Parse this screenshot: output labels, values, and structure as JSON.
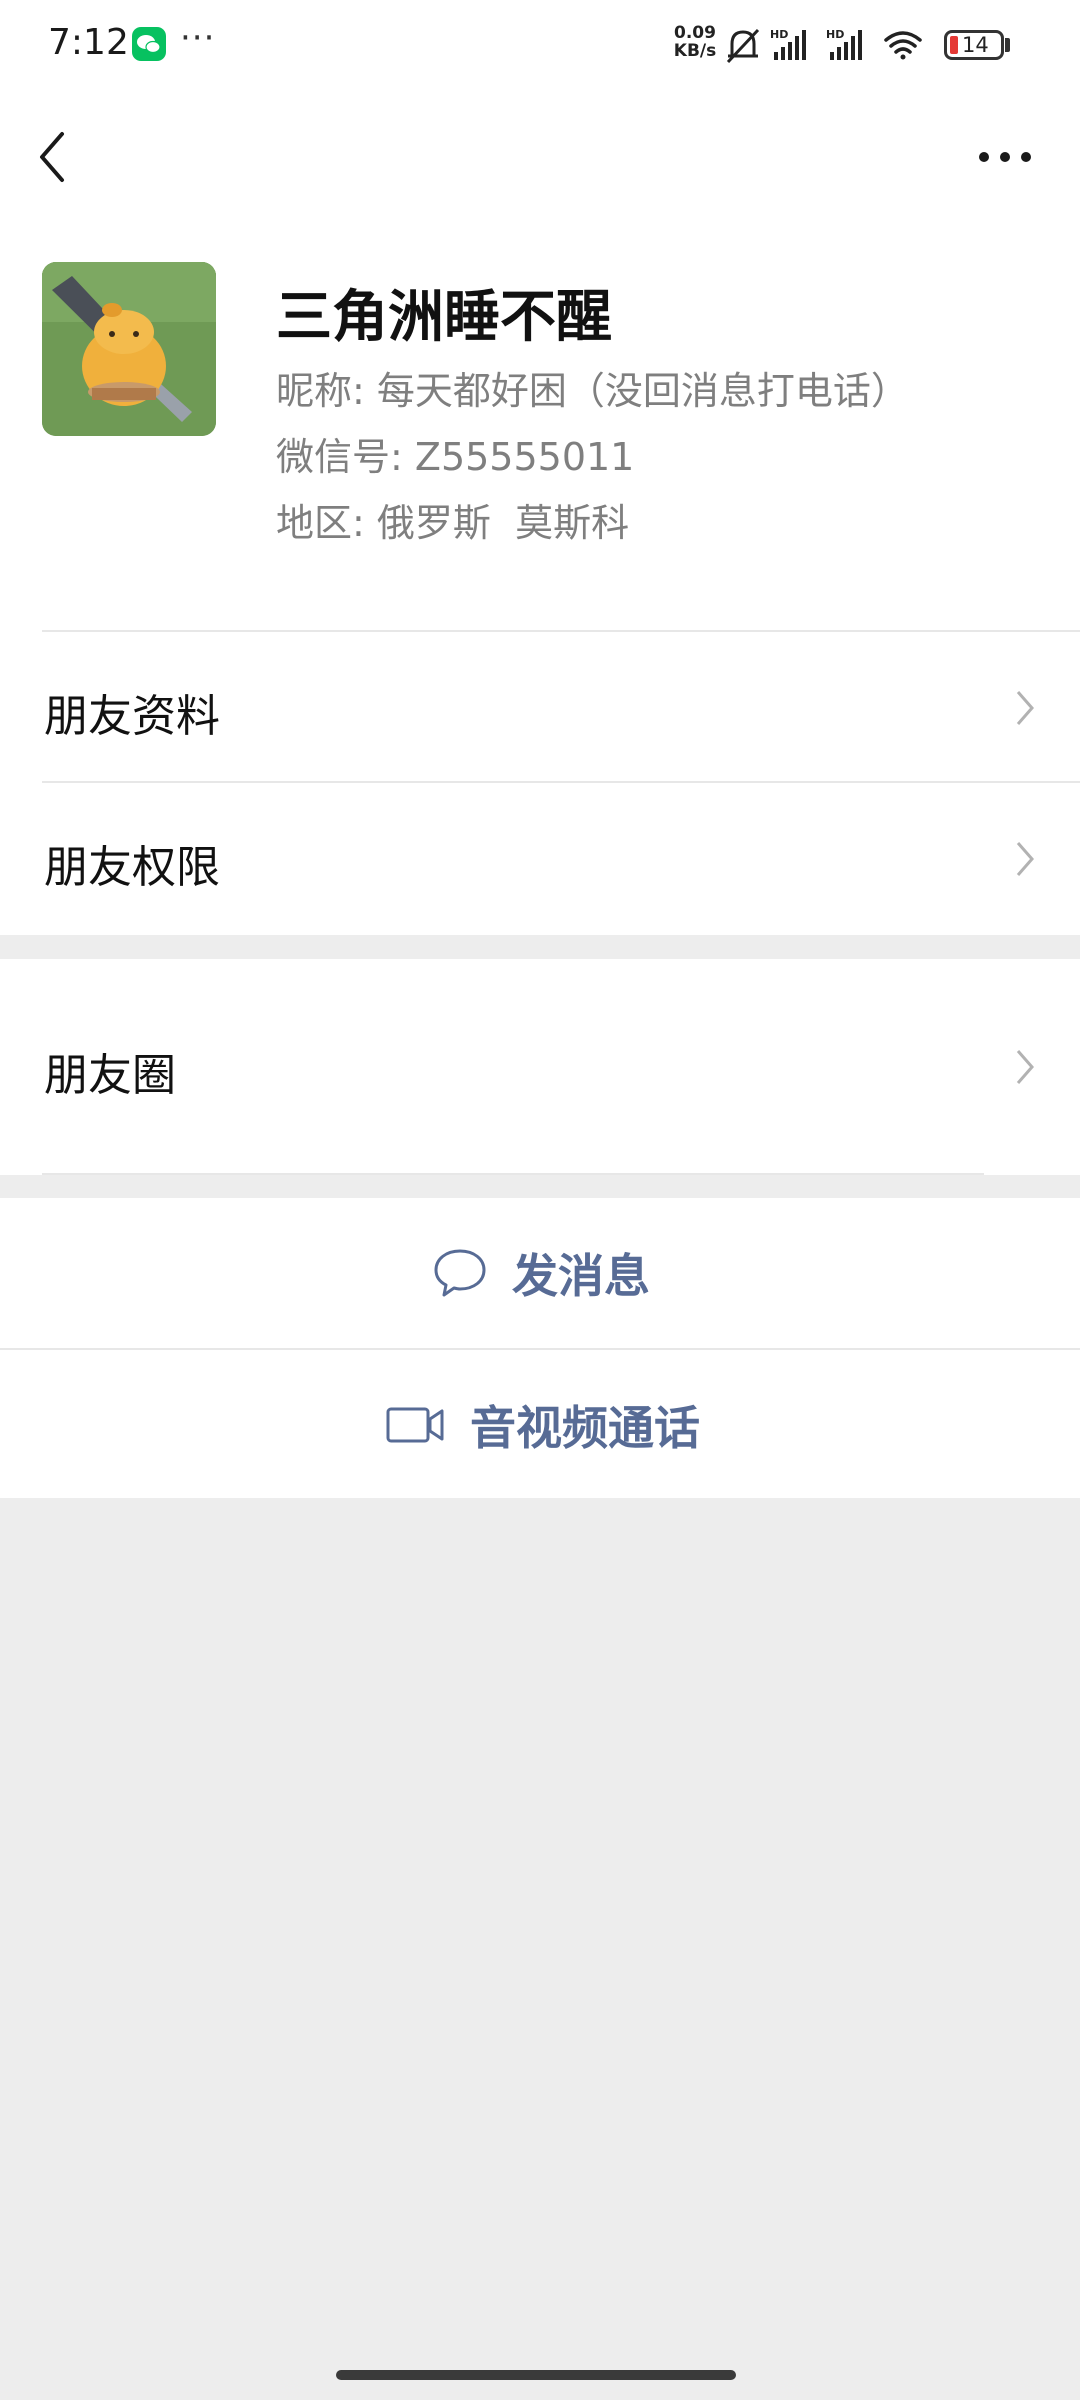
{
  "status_bar": {
    "time": "7:12",
    "more": "···",
    "net_speed_value": "0.09",
    "net_speed_unit": "KB/s",
    "battery": "14",
    "icons": [
      "wechat-notification-icon",
      "mute-bell-icon",
      "hd-signal-icon",
      "hd-signal-icon",
      "wifi-icon",
      "battery-icon"
    ]
  },
  "nav": {
    "back_icon": "chevron-left-icon",
    "more_icon": "more-dots-icon"
  },
  "profile": {
    "name": "三角洲睡不醒",
    "nickname_label": "昵称:",
    "nickname_value": "每天都好困（没回消息打电话）",
    "wechat_id_label": "微信号:",
    "wechat_id_value": "Z55555011",
    "region_label": "地区:",
    "region_value": "俄罗斯  莫斯科"
  },
  "menu": {
    "friend_info": "朋友资料",
    "friend_permissions": "朋友权限",
    "moments": "朋友圈"
  },
  "actions": {
    "send_message": "发消息",
    "voice_video_call": "音视频通话"
  },
  "colors": {
    "link_blue": "#576b95",
    "background_gray": "#ededed",
    "wechat_green": "#07c160"
  }
}
